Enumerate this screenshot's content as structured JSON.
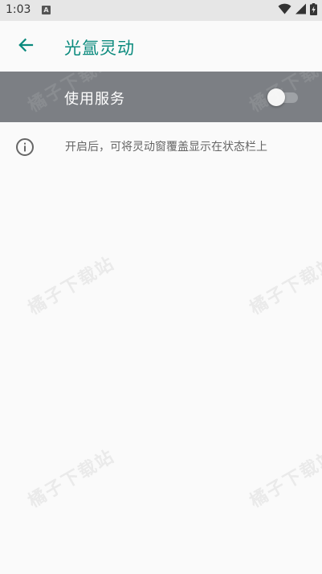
{
  "status_bar": {
    "time": "1:03",
    "notification_letter": "A",
    "icons": [
      "wifi-icon",
      "signal-icon",
      "battery-charging-icon"
    ]
  },
  "app_bar": {
    "back_icon": "arrow-left-icon",
    "title": "光氲灵动",
    "accent_color": "#0a8a7d"
  },
  "service": {
    "label": "使用服务",
    "enabled": false,
    "row_color": "#7c7f84"
  },
  "info": {
    "icon": "info-icon",
    "text": "开启后，可将灵动窗覆盖显示在状态栏上"
  },
  "watermark": {
    "text": "橘子下载站"
  }
}
